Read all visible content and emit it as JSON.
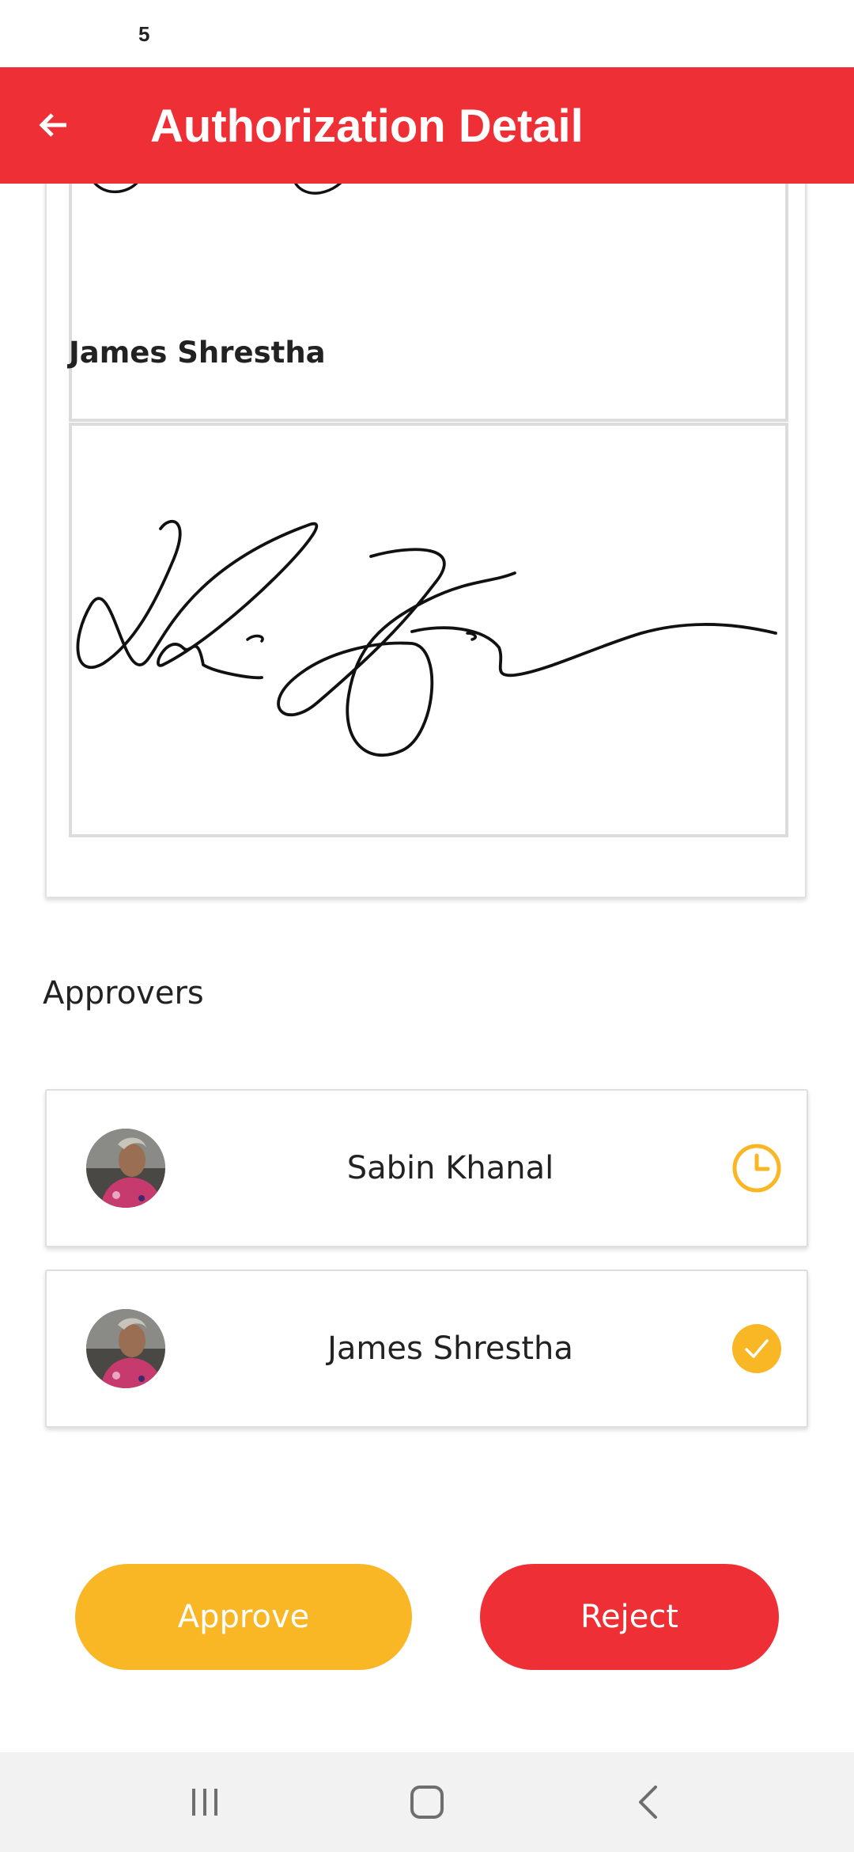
{
  "status_bar": {
    "time": "5"
  },
  "app_bar": {
    "title": "Authorization Detail",
    "back_icon": "arrow-left-icon"
  },
  "signatures": {
    "signer_name": "James Shrestha"
  },
  "approvers": {
    "section_title": "Approvers",
    "items": [
      {
        "name": "Sabin Khanal",
        "status": "pending",
        "status_icon": "clock-icon"
      },
      {
        "name": "James Shrestha",
        "status": "approved",
        "status_icon": "check-circle-icon"
      }
    ]
  },
  "actions": {
    "approve_label": "Approve",
    "reject_label": "Reject"
  },
  "navigation_bar": {
    "icons": [
      "recent-apps-icon",
      "home-icon",
      "back-icon"
    ]
  },
  "colors": {
    "primary_red": "#ee2f35",
    "accent_yellow": "#f9b625",
    "nav_background": "#f2f2f2"
  }
}
